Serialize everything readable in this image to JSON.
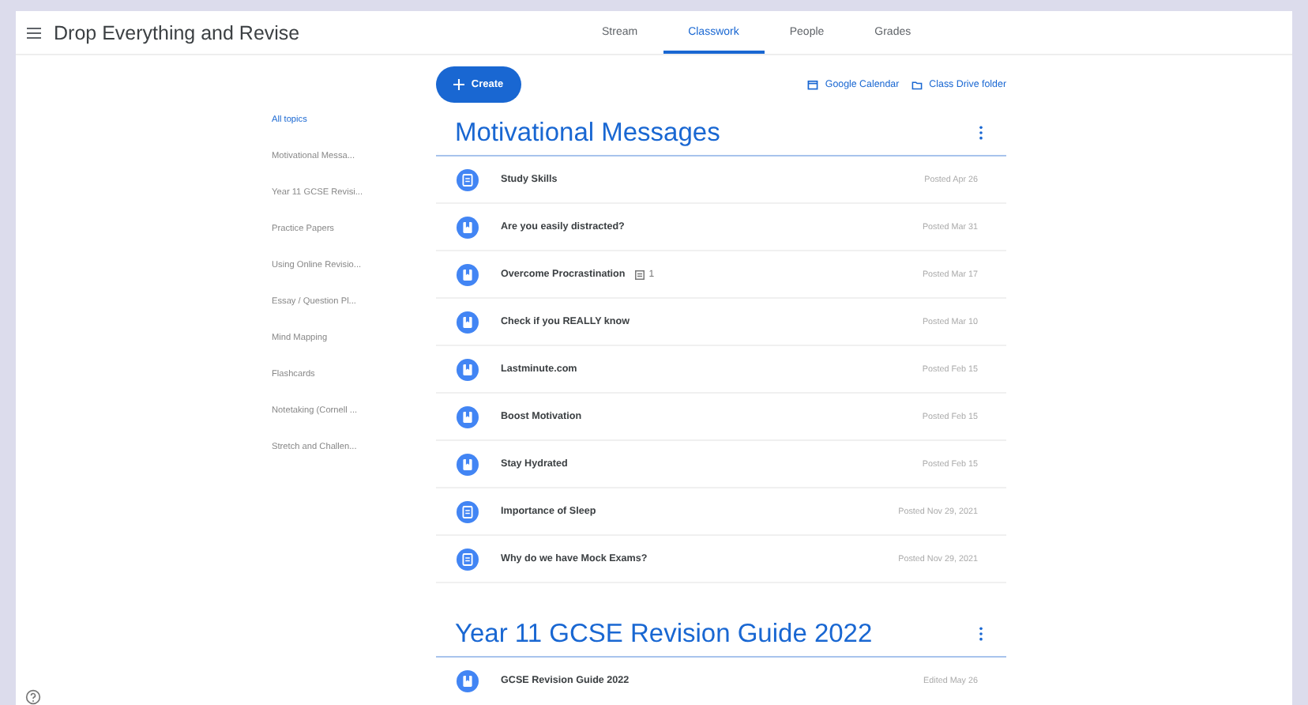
{
  "header": {
    "title": "Drop Everything and Revise",
    "tabs": [
      {
        "label": "Stream",
        "selected": false
      },
      {
        "label": "Classwork",
        "selected": true
      },
      {
        "label": "People",
        "selected": false
      },
      {
        "label": "Grades",
        "selected": false
      }
    ]
  },
  "toolbar": {
    "create": "Create",
    "links": [
      {
        "label": "Google Calendar",
        "kind": "calendar"
      },
      {
        "label": "Class Drive folder",
        "kind": "drive"
      }
    ]
  },
  "topics": [
    {
      "label": "All topics",
      "selected": true
    },
    {
      "label": "Motivational Messa...",
      "selected": false
    },
    {
      "label": "Year 11 GCSE Revisi...",
      "selected": false
    },
    {
      "label": "Practice Papers",
      "selected": false
    },
    {
      "label": "Using Online Revisio...",
      "selected": false
    },
    {
      "label": "Essay / Question Pl...",
      "selected": false
    },
    {
      "label": "Mind Mapping",
      "selected": false
    },
    {
      "label": "Flashcards",
      "selected": false
    },
    {
      "label": "Notetaking (Cornell ...",
      "selected": false
    },
    {
      "label": "Stretch and Challen...",
      "selected": false
    }
  ],
  "sections": [
    {
      "title": "Motivational Messages",
      "items": [
        {
          "kind": "assignment",
          "title": "Study Skills",
          "date": "Posted Apr 26"
        },
        {
          "kind": "material",
          "title": "Are you easily distracted?",
          "date": "Posted Mar 31"
        },
        {
          "kind": "material",
          "title": "Overcome Procrastination",
          "attachments": "1",
          "date": "Posted Mar 17"
        },
        {
          "kind": "material",
          "title": "Check if you REALLY know",
          "date": "Posted Mar 10"
        },
        {
          "kind": "material",
          "title": "Lastminute.com",
          "date": "Posted Feb 15"
        },
        {
          "kind": "material",
          "title": "Boost Motivation",
          "date": "Posted Feb 15"
        },
        {
          "kind": "material",
          "title": "Stay Hydrated",
          "date": "Posted Feb 15"
        },
        {
          "kind": "assignment",
          "title": "Importance of Sleep",
          "date": "Posted Nov 29, 2021"
        },
        {
          "kind": "assignment",
          "title": "Why do we have Mock Exams?",
          "date": "Posted Nov 29, 2021"
        }
      ]
    },
    {
      "title": "Year 11 GCSE Revision Guide 2022",
      "items": [
        {
          "kind": "material",
          "title": "GCSE Revision Guide 2022",
          "date": "Edited May 26"
        }
      ]
    }
  ]
}
